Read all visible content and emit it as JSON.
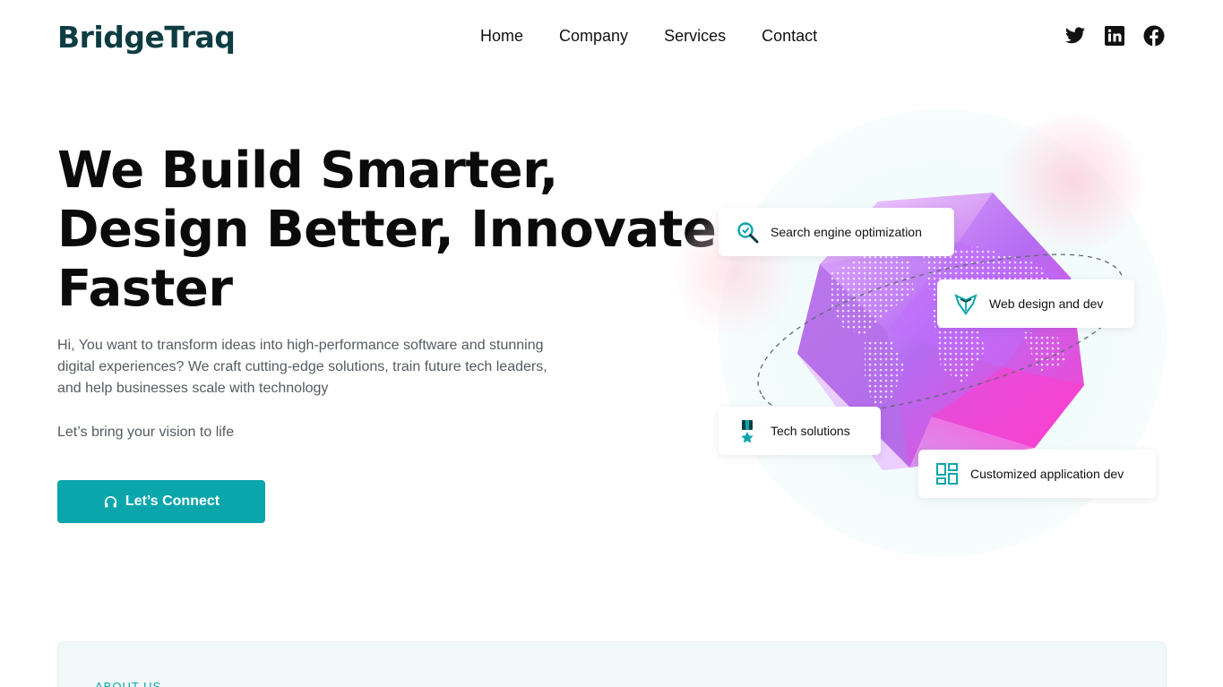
{
  "brand": {
    "name": "BridgeTraq"
  },
  "nav": [
    "Home",
    "Company",
    "Services",
    "Contact"
  ],
  "socials": [
    "twitter-icon",
    "linkedin-icon",
    "facebook-icon"
  ],
  "hero": {
    "title_lines": [
      "We Build Smarter,",
      "Design Better, Innovate",
      "Faster"
    ],
    "description": "Hi, You want to transform ideas into high-performance software and stunning digital experiences? We craft cutting-edge solutions, train future tech leaders, and help businesses scale with technology",
    "subtext": "Let’s bring your vision to life",
    "cta_label": "Let’s Connect"
  },
  "services": [
    {
      "label": "Search engine optimization",
      "icon": "seo-magnifier-icon"
    },
    {
      "label": "Web design and dev",
      "icon": "web-design-icon"
    },
    {
      "label": "Tech solutions",
      "icon": "medal-icon"
    },
    {
      "label": "Customized application dev",
      "icon": "grid-layout-icon"
    }
  ],
  "about": {
    "label": "ABOUT US"
  },
  "colors": {
    "accent": "#0aa6ac",
    "brand": "#0d3d43"
  }
}
